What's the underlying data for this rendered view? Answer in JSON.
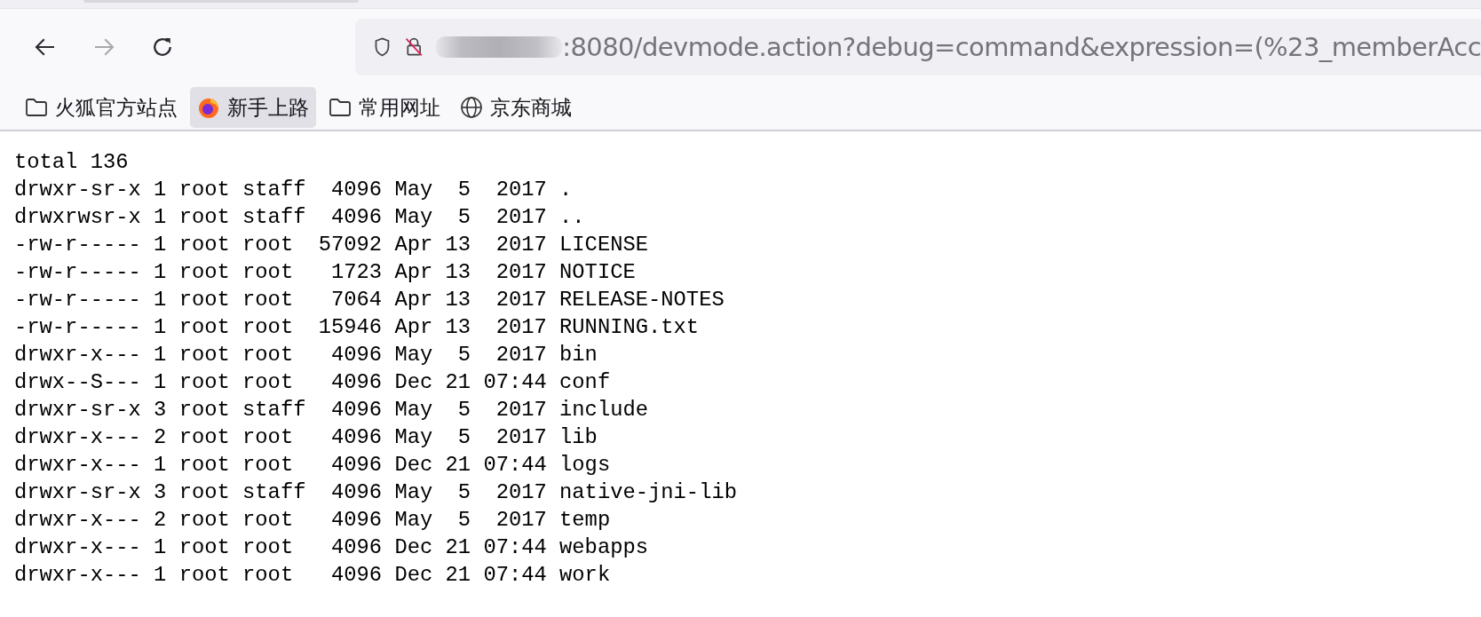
{
  "toolbar": {
    "back_disabled": false,
    "forward_disabled": true
  },
  "address_bar": {
    "redacted": true,
    "url": ":8080/devmode.action?debug=command&expression=(%23_memberAcc"
  },
  "bookmarks": [
    {
      "label": "火狐官方站点",
      "kind": "folder",
      "selected": false
    },
    {
      "label": "新手上路",
      "kind": "firefox",
      "selected": true
    },
    {
      "label": "常用网址",
      "kind": "folder",
      "selected": false
    },
    {
      "label": "京东商城",
      "kind": "globe",
      "selected": false
    }
  ],
  "output_lines": [
    "total 136",
    "drwxr-sr-x 1 root staff  4096 May  5  2017 .",
    "drwxrwsr-x 1 root staff  4096 May  5  2017 ..",
    "-rw-r----- 1 root root  57092 Apr 13  2017 LICENSE",
    "-rw-r----- 1 root root   1723 Apr 13  2017 NOTICE",
    "-rw-r----- 1 root root   7064 Apr 13  2017 RELEASE-NOTES",
    "-rw-r----- 1 root root  15946 Apr 13  2017 RUNNING.txt",
    "drwxr-x--- 1 root root   4096 May  5  2017 bin",
    "drwx--S--- 1 root root   4096 Dec 21 07:44 conf",
    "drwxr-sr-x 3 root staff  4096 May  5  2017 include",
    "drwxr-x--- 2 root root   4096 May  5  2017 lib",
    "drwxr-x--- 1 root root   4096 Dec 21 07:44 logs",
    "drwxr-sr-x 3 root staff  4096 May  5  2017 native-jni-lib",
    "drwxr-x--- 2 root root   4096 May  5  2017 temp",
    "drwxr-x--- 1 root root   4096 Dec 21 07:44 webapps",
    "drwxr-x--- 1 root root   4096 Dec 21 07:44 work"
  ]
}
